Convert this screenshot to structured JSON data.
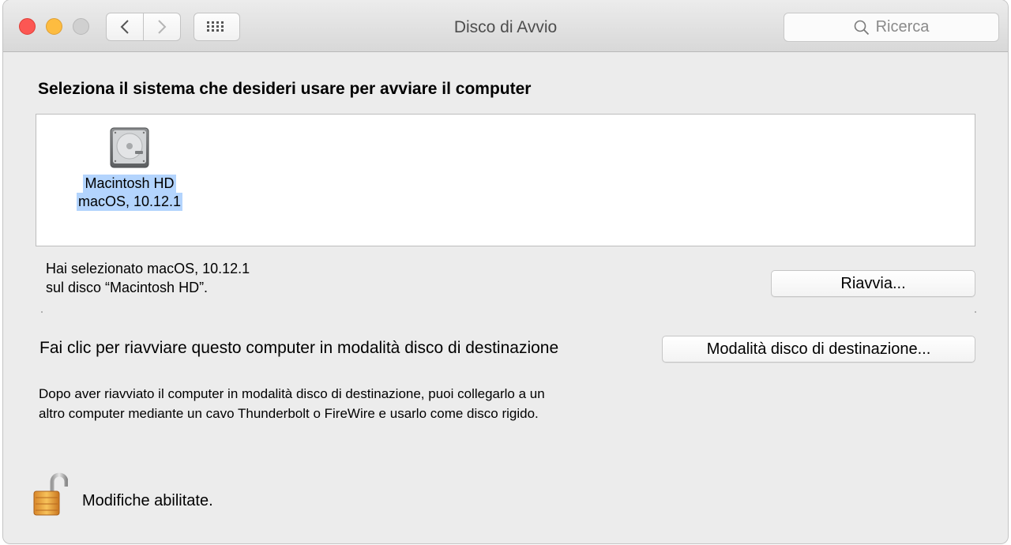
{
  "window": {
    "title": "Disco di Avvio",
    "search_placeholder": "Ricerca",
    "traffic_colors": {
      "close": "#fc5753",
      "minimize": "#fdbc40",
      "zoom": "#d0d0d0"
    }
  },
  "main": {
    "heading": "Seleziona il sistema che desideri usare per avviare il computer",
    "disks": [
      {
        "name": "Macintosh HD",
        "system": "macOS, 10.12.1",
        "icon": "hard-drive-icon",
        "selected": true
      }
    ],
    "selected_info": {
      "line1": "Hai selezionato macOS, 10.12.1",
      "line2": "sul disco “Macintosh HD”."
    },
    "restart_button": "Riavvia...",
    "target_mode": {
      "label": "Fai clic per riavviare questo computer in modalità disco di destinazione",
      "button": "Modalità disco di destinazione...",
      "description_line1": "Dopo aver riavviato il computer in modalità disco di destinazione, puoi collegarlo a un",
      "description_line2": "altro computer mediante un cavo Thunderbolt o FireWire e usarlo come disco rigido."
    }
  },
  "footer": {
    "lock_label": "Modifiche abilitate.",
    "lock_icon": "unlocked-padlock-icon"
  },
  "colors": {
    "selection_highlight": "#b3d4fd",
    "window_background": "#ececec"
  }
}
